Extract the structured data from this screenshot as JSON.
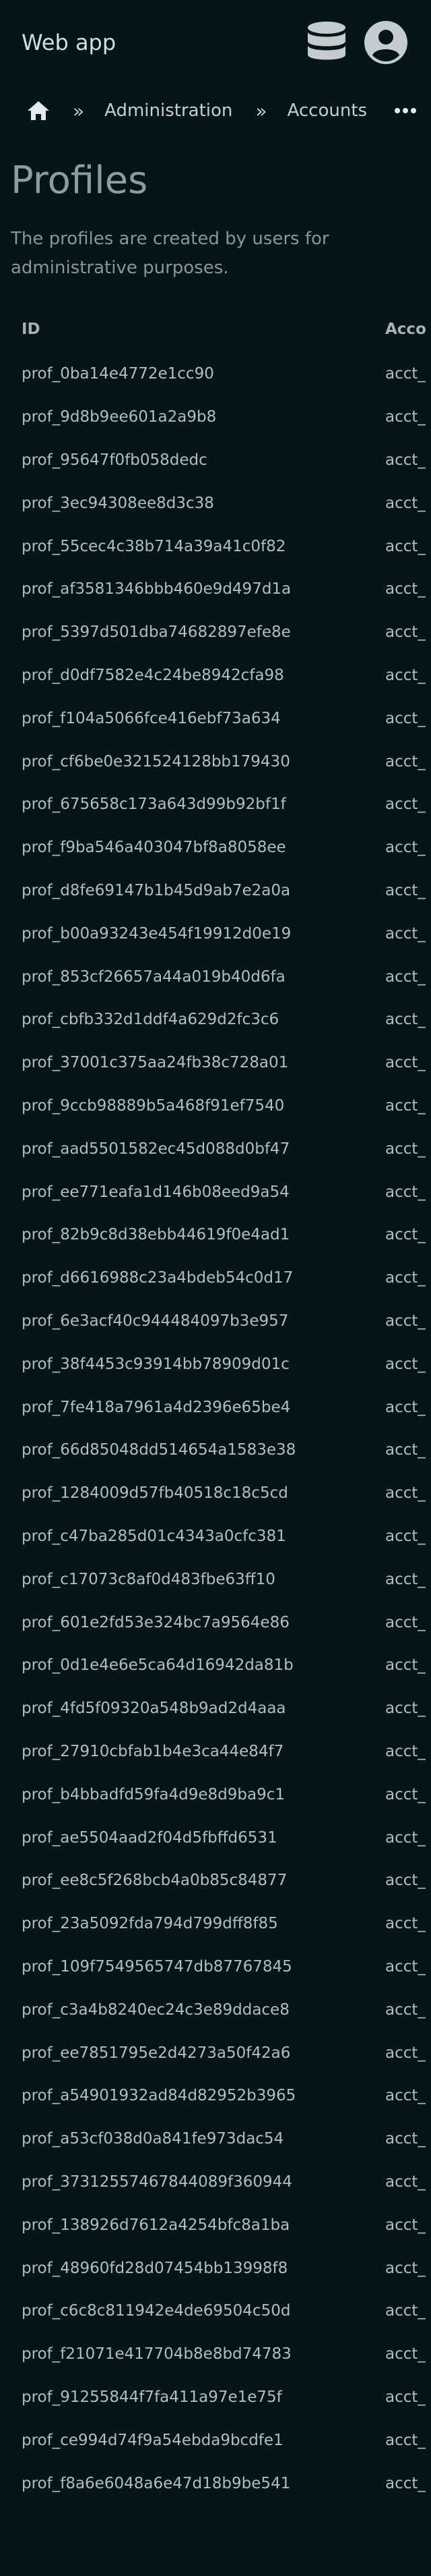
{
  "app": {
    "title": "Web app",
    "icons": [
      "database-icon",
      "account-circle-icon"
    ]
  },
  "breadcrumb": {
    "home_icon": "home-icon",
    "separator": "»",
    "items": [
      "Administration",
      "Accounts"
    ],
    "more_icon": "more-horizontal-icon"
  },
  "page": {
    "title": "Profiles",
    "description": "The profiles are created by users for administrative purposes."
  },
  "table": {
    "headers": {
      "id": "ID",
      "account": "Acco"
    },
    "rows": [
      {
        "id": "prof_0ba14e4772e1cc90",
        "account": "acct_"
      },
      {
        "id": "prof_9d8b9ee601a2a9b8",
        "account": "acct_"
      },
      {
        "id": "prof_95647f0fb058dedc",
        "account": "acct_"
      },
      {
        "id": "prof_3ec94308ee8d3c38",
        "account": "acct_"
      },
      {
        "id": "prof_55cec4c38b714a39a41c0f82",
        "account": "acct_"
      },
      {
        "id": "prof_af3581346bbb460e9d497d1a",
        "account": "acct_"
      },
      {
        "id": "prof_5397d501dba74682897efe8e",
        "account": "acct_"
      },
      {
        "id": "prof_d0df7582e4c24be8942cfa98",
        "account": "acct_"
      },
      {
        "id": "prof_f104a5066fce416ebf73a634",
        "account": "acct_"
      },
      {
        "id": "prof_cf6be0e321524128bb179430",
        "account": "acct_"
      },
      {
        "id": "prof_675658c173a643d99b92bf1f",
        "account": "acct_"
      },
      {
        "id": "prof_f9ba546a403047bf8a8058ee",
        "account": "acct_"
      },
      {
        "id": "prof_d8fe69147b1b45d9ab7e2a0a",
        "account": "acct_"
      },
      {
        "id": "prof_b00a93243e454f19912d0e19",
        "account": "acct_"
      },
      {
        "id": "prof_853cf26657a44a019b40d6fa",
        "account": "acct_"
      },
      {
        "id": "prof_cbfb332d1ddf4a629d2fc3c6",
        "account": "acct_"
      },
      {
        "id": "prof_37001c375aa24fb38c728a01",
        "account": "acct_"
      },
      {
        "id": "prof_9ccb98889b5a468f91ef7540",
        "account": "acct_"
      },
      {
        "id": "prof_aad5501582ec45d088d0bf47",
        "account": "acct_"
      },
      {
        "id": "prof_ee771eafa1d146b08eed9a54",
        "account": "acct_"
      },
      {
        "id": "prof_82b9c8d38ebb44619f0e4ad1",
        "account": "acct_"
      },
      {
        "id": "prof_d6616988c23a4bdeb54c0d17",
        "account": "acct_"
      },
      {
        "id": "prof_6e3acf40c944484097b3e957",
        "account": "acct_"
      },
      {
        "id": "prof_38f4453c93914bb78909d01c",
        "account": "acct_"
      },
      {
        "id": "prof_7fe418a7961a4d2396e65be4",
        "account": "acct_"
      },
      {
        "id": "prof_66d85048dd514654a1583e38",
        "account": "acct_"
      },
      {
        "id": "prof_1284009d57fb40518c18c5cd",
        "account": "acct_"
      },
      {
        "id": "prof_c47ba285d01c4343a0cfc381",
        "account": "acct_"
      },
      {
        "id": "prof_c17073c8af0d483fbe63ff10",
        "account": "acct_"
      },
      {
        "id": "prof_601e2fd53e324bc7a9564e86",
        "account": "acct_"
      },
      {
        "id": "prof_0d1e4e6e5ca64d16942da81b",
        "account": "acct_"
      },
      {
        "id": "prof_4fd5f09320a548b9ad2d4aaa",
        "account": "acct_"
      },
      {
        "id": "prof_27910cbfab1b4e3ca44e84f7",
        "account": "acct_"
      },
      {
        "id": "prof_b4bbadfd59fa4d9e8d9ba9c1",
        "account": "acct_"
      },
      {
        "id": "prof_ae5504aad2f04d5fbffd6531",
        "account": "acct_"
      },
      {
        "id": "prof_ee8c5f268bcb4a0b85c84877",
        "account": "acct_"
      },
      {
        "id": "prof_23a5092fda794d799dff8f85",
        "account": "acct_"
      },
      {
        "id": "prof_109f7549565747db87767845",
        "account": "acct_"
      },
      {
        "id": "prof_c3a4b8240ec24c3e89ddace8",
        "account": "acct_"
      },
      {
        "id": "prof_ee7851795e2d4273a50f42a6",
        "account": "acct_"
      },
      {
        "id": "prof_a54901932ad84d82952b3965",
        "account": "acct_"
      },
      {
        "id": "prof_a53cf038d0a841fe973dac54",
        "account": "acct_"
      },
      {
        "id": "prof_37312557467844089f360944",
        "account": "acct_"
      },
      {
        "id": "prof_138926d7612a4254bfc8a1ba",
        "account": "acct_"
      },
      {
        "id": "prof_48960fd28d07454bb13998f8",
        "account": "acct_"
      },
      {
        "id": "prof_c6c8c811942e4de69504c50d",
        "account": "acct_"
      },
      {
        "id": "prof_f21071e417704b8e8bd74783",
        "account": "acct_"
      },
      {
        "id": "prof_91255844f7fa411a97e1e75f",
        "account": "acct_"
      },
      {
        "id": "prof_ce994d74f9a54ebda9bcdfe1",
        "account": "acct_"
      },
      {
        "id": "prof_f8a6e6048a6e47d18b9be541",
        "account": "acct_"
      }
    ]
  }
}
